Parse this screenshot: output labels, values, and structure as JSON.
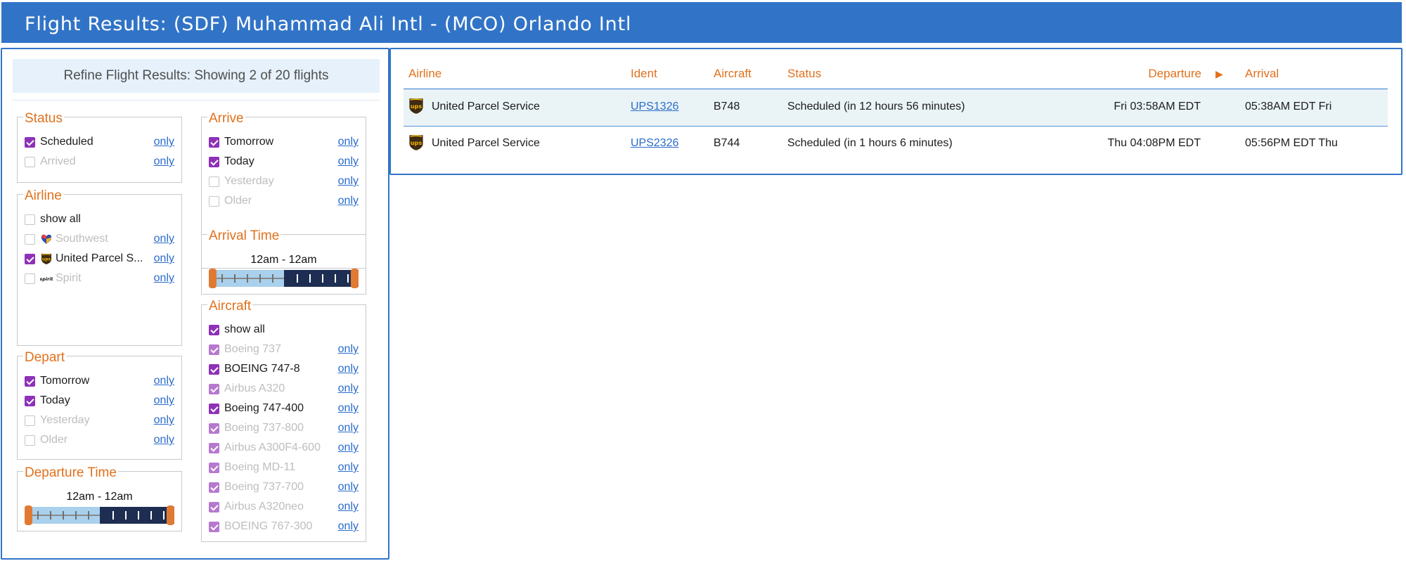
{
  "header": {
    "title": "Flight Results: (SDF) Muhammad Ali Intl - (MCO) Orlando Intl"
  },
  "refine": {
    "summary": "Refine Flight Results: Showing 2 of 20 flights"
  },
  "filters": {
    "only_label": "only",
    "status": {
      "title": "Status",
      "items": [
        {
          "label": "Scheduled",
          "checked": true,
          "enabled": true
        },
        {
          "label": "Arrived",
          "checked": false,
          "enabled": false
        }
      ]
    },
    "airline": {
      "title": "Airline",
      "show_all": "show all",
      "items": [
        {
          "label": "Southwest",
          "checked": false,
          "enabled": false,
          "icon": "southwest-logo-icon"
        },
        {
          "label": "United Parcel S...",
          "checked": true,
          "enabled": true,
          "icon": "ups-logo-icon"
        },
        {
          "label": "Spirit",
          "checked": false,
          "enabled": false,
          "icon": "spirit-logo-icon"
        }
      ],
      "spirit_logo_text": "spirit"
    },
    "depart": {
      "title": "Depart",
      "items": [
        {
          "label": "Tomorrow",
          "checked": true,
          "enabled": true
        },
        {
          "label": "Today",
          "checked": true,
          "enabled": true
        },
        {
          "label": "Yesterday",
          "checked": false,
          "enabled": false
        },
        {
          "label": "Older",
          "checked": false,
          "enabled": false
        }
      ]
    },
    "departure_time": {
      "title": "Departure Time",
      "range": "12am - 12am"
    },
    "arrive": {
      "title": "Arrive",
      "items": [
        {
          "label": "Tomorrow",
          "checked": true,
          "enabled": true
        },
        {
          "label": "Today",
          "checked": true,
          "enabled": true
        },
        {
          "label": "Yesterday",
          "checked": false,
          "enabled": false
        },
        {
          "label": "Older",
          "checked": false,
          "enabled": false
        }
      ]
    },
    "arrival_time": {
      "title": "Arrival Time",
      "range": "12am - 12am"
    },
    "aircraft": {
      "title": "Aircraft",
      "show_all": "show all",
      "items": [
        {
          "label": "Boeing 737",
          "enabled": false
        },
        {
          "label": "BOEING 747-8",
          "enabled": true
        },
        {
          "label": "Airbus A320",
          "enabled": false
        },
        {
          "label": "Boeing 747-400",
          "enabled": true
        },
        {
          "label": "Boeing 737-800",
          "enabled": false
        },
        {
          "label": "Airbus A300F4-600",
          "enabled": false
        },
        {
          "label": "Boeing MD-11",
          "enabled": false
        },
        {
          "label": "Boeing 737-700",
          "enabled": false
        },
        {
          "label": "Airbus A320neo",
          "enabled": false
        },
        {
          "label": "BOEING 767-300",
          "enabled": false
        }
      ]
    }
  },
  "table": {
    "columns": {
      "airline": "Airline",
      "ident": "Ident",
      "aircraft": "Aircraft",
      "status": "Status",
      "departure": "Departure",
      "sort_arrow": "▶",
      "arrival": "Arrival"
    },
    "rows": [
      {
        "airline": "United Parcel Service",
        "ident": "UPS1326",
        "aircraft": "B748",
        "status": "Scheduled (in 12 hours 56 minutes)",
        "departure": "Fri 03:58AM EDT",
        "arrival": "05:38AM EDT Fri"
      },
      {
        "airline": "United Parcel Service",
        "ident": "UPS2326",
        "aircraft": "B744",
        "status": "Scheduled (in 1 hours 6 minutes)",
        "departure": "Thu 04:08PM EDT",
        "arrival": "05:56PM EDT Thu"
      }
    ]
  },
  "colors": {
    "header": "#3174c7",
    "accent": "#e0711c",
    "checkbox": "#8e31b8",
    "link": "#2b6ccc",
    "row_highlight": "#eaf3f6"
  }
}
